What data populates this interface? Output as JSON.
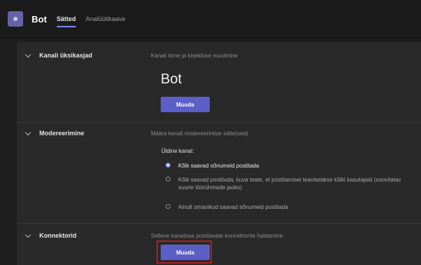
{
  "header": {
    "title": "Bot",
    "tabs": [
      {
        "label": "Sätted",
        "active": true
      },
      {
        "label": "Analüütikaave",
        "active": false
      }
    ]
  },
  "sections": {
    "channel": {
      "label": "Kanali üksikasjad",
      "description": "Kanali nime ja kirjelduse muutmine",
      "name": "Bot",
      "button_label": "Muuda"
    },
    "moderation": {
      "label": "Modereerimine",
      "description": "Määra kanali modereerimise sätte(sed)",
      "general_label": "Üldine kanal:",
      "options": [
        {
          "label": "Kõik saavad sõnumeid postitada",
          "checked": true
        },
        {
          "label": "Kõik saavad postitada, kuva teate, et postitamisel teavitatakse kõiki kasutajaid (soovitatav suurte töörühmade jaoks)",
          "checked": false
        },
        {
          "label": "Ainult omanikud saavad sõnumeid postitada",
          "checked": false
        }
      ]
    },
    "connectors": {
      "label": "Konnektorid",
      "description": "Selleoe kanalisse postitavate konnektorite haldamine",
      "button_label": "Muuda"
    }
  },
  "colors": {
    "accent": "#5b5fc7",
    "highlight": "#b11f1f",
    "background": "#1f1f1f",
    "panel": "#292929"
  }
}
